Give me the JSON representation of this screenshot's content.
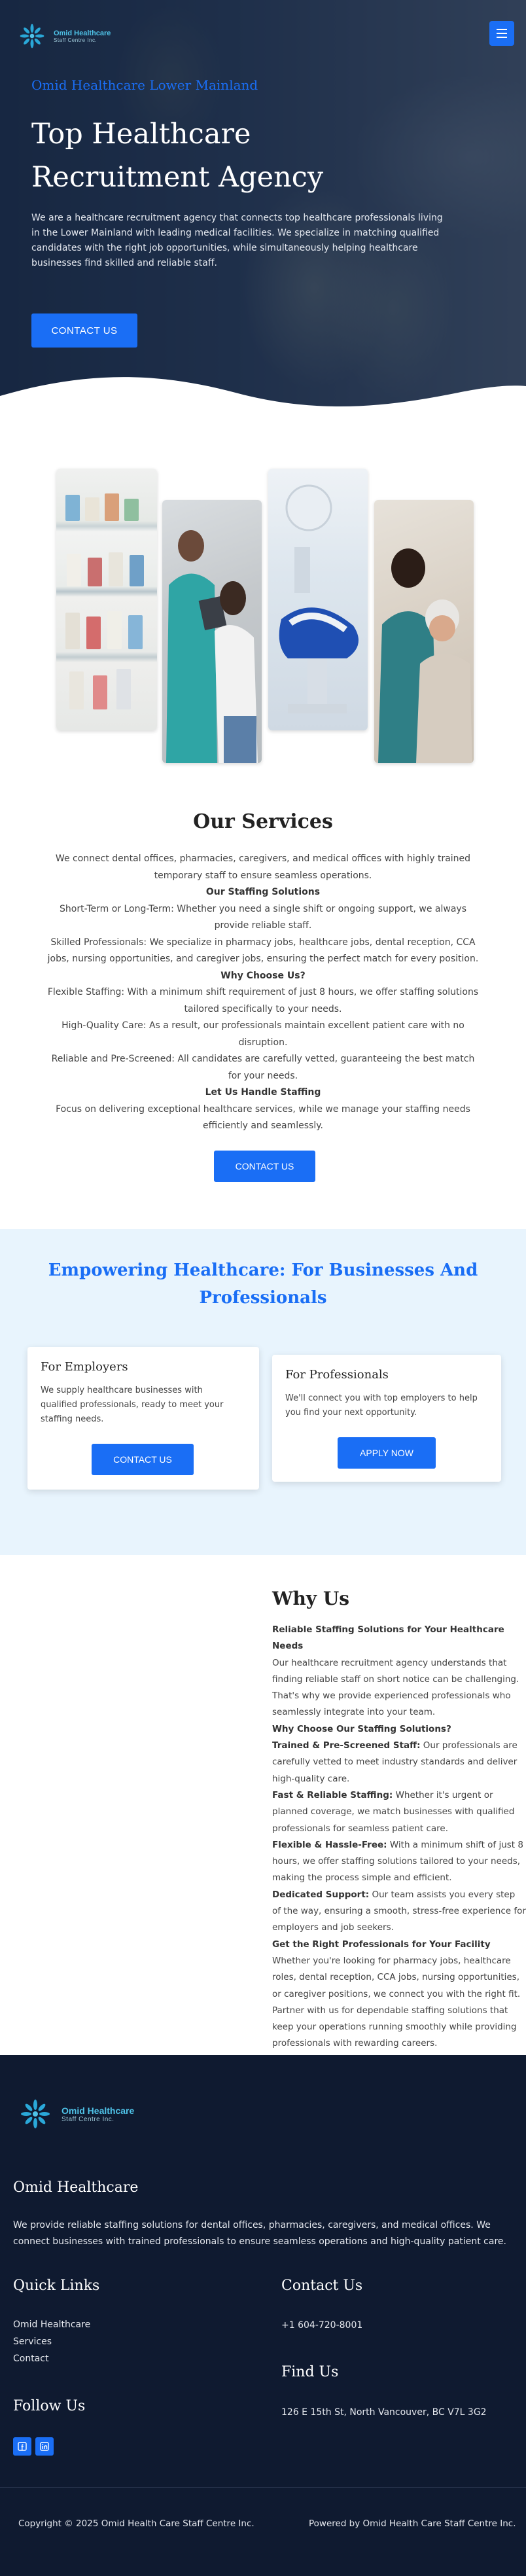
{
  "brand": {
    "name_line1": "Omid Healthcare",
    "name_line2": "Staff Centre Inc."
  },
  "hero": {
    "eyebrow": "Omid Healthcare Lower Mainland",
    "title": "Top Healthcare Recruitment Agency",
    "description": "We are a healthcare recruitment agency that connects top healthcare professionals living in the Lower Mainland with leading medical facilities. We specialize in matching qualified candidates with the right job opportunities, while simultaneously helping healthcare businesses find skilled and reliable staff.",
    "cta": "CONTACT US"
  },
  "services": {
    "title": "Our Services",
    "lines": [
      {
        "type": "p",
        "text": "We connect dental offices, pharmacies, caregivers, and medical offices with highly trained temporary staff to ensure seamless operations."
      },
      {
        "type": "strong",
        "text": "Our Staffing Solutions"
      },
      {
        "type": "p",
        "text": "Short-Term or Long-Term: Whether you need a single shift or ongoing support, we always provide reliable staff."
      },
      {
        "type": "p",
        "text": "Skilled Professionals: We specialize in pharmacy jobs, healthcare jobs, dental reception, CCA jobs, nursing opportunities, and caregiver jobs, ensuring the perfect match for every position."
      },
      {
        "type": "strong",
        "text": "Why Choose Us?"
      },
      {
        "type": "p",
        "text": "Flexible Staffing: With a minimum shift requirement of just 8 hours, we offer staffing solutions tailored specifically to your needs."
      },
      {
        "type": "p",
        "text": "High-Quality Care: As a result, our professionals maintain excellent patient care with no disruption."
      },
      {
        "type": "p",
        "text": "Reliable and Pre-Screened: All candidates are carefully vetted, guaranteeing the best match for your needs."
      },
      {
        "type": "strong",
        "text": "Let Us Handle Staffing"
      },
      {
        "type": "p",
        "text": "Focus on delivering exceptional healthcare services, while we manage your staffing needs efficiently and seamlessly."
      }
    ],
    "cta": "CONTACT US"
  },
  "empowering": {
    "title": "Empowering Healthcare: For Businesses And Professionals",
    "employers": {
      "title": "For Employers",
      "text": "We supply healthcare businesses with qualified professionals, ready to meet your staffing needs.",
      "cta": "CONTACT US"
    },
    "professionals": {
      "title": "For Professionals",
      "text": "We'll connect you with top employers to help you find your next opportunity.",
      "cta": "APPLY NOW"
    }
  },
  "why": {
    "title": "Why Us",
    "blocks": [
      {
        "lead": "Reliable Staffing Solutions for Your Healthcare Needs",
        "text": ""
      },
      {
        "lead": "",
        "text": "Our healthcare recruitment agency understands that finding reliable staff on short notice can be challenging. That's why we provide experienced professionals who seamlessly integrate into your team."
      },
      {
        "lead": "Why Choose Our Staffing Solutions?",
        "text": ""
      },
      {
        "lead": "Trained & Pre-Screened Staff:",
        "text": " Our professionals are carefully vetted to meet industry standards and deliver high-quality care."
      },
      {
        "lead": "Fast & Reliable Staffing:",
        "text": " Whether it's urgent or planned coverage, we match businesses with qualified professionals for seamless patient care."
      },
      {
        "lead": "Flexible & Hassle-Free:",
        "text": " With a minimum shift of just 8 hours, we offer staffing solutions tailored to your needs, making the process simple and efficient."
      },
      {
        "lead": "Dedicated Support:",
        "text": " Our team assists you every step of the way, ensuring a smooth, stress-free experience for employers and job seekers."
      },
      {
        "lead": "Get the Right Professionals for Your Facility",
        "text": ""
      },
      {
        "lead": "",
        "text": "Whether you're looking for pharmacy jobs, healthcare roles, dental reception, CCA jobs, nursing opportunities, or caregiver positions, we connect you with the right fit. Partner with us for dependable staffing solutions that keep your operations running smoothly while providing professionals with rewarding careers."
      }
    ]
  },
  "footer": {
    "title": "Omid Healthcare",
    "description": "We provide reliable staffing solutions for dental offices, pharmacies, caregivers, and medical offices. We connect businesses with trained professionals to ensure seamless operations and high-quality patient care.",
    "quick_links_title": "Quick Links",
    "quick_links": [
      "Omid Healthcare",
      "Services",
      "Contact"
    ],
    "contact_title": "Contact Us",
    "phone": "+1 604-720-8001",
    "find_title": "Find Us",
    "address": "126 E 15th St, North Vancouver, BC V7L 3G2",
    "follow_title": "Follow Us",
    "social_icons": [
      "facebook-icon",
      "linkedin-icon"
    ],
    "copyright": "Copyright © 2025 Omid Health Care Staff Centre Inc.",
    "powered": "Powered by Omid Health Care Staff Centre Inc."
  },
  "colors": {
    "accent": "#1a6ef5",
    "footer_bg": "#0f1a30",
    "empower_bg": "#e8f4fd"
  }
}
